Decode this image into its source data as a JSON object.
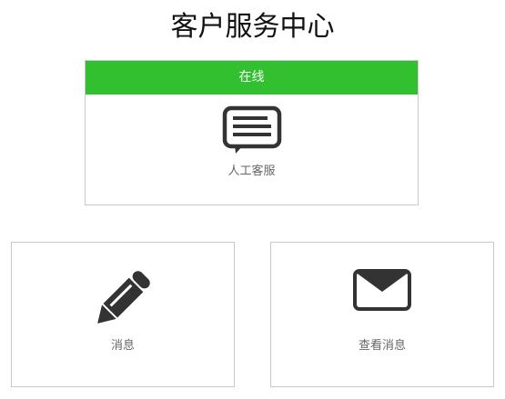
{
  "header": {
    "title": "客户服务中心"
  },
  "main_card": {
    "status": "在线",
    "label": "人工客服",
    "icon": "chat-bubble-icon",
    "status_color": "#33c030"
  },
  "cards": [
    {
      "label": "消息",
      "icon": "pencil-icon"
    },
    {
      "label": "查看消息",
      "icon": "envelope-icon"
    }
  ],
  "colors": {
    "accent": "#33c030",
    "icon": "#333333",
    "label": "#666666",
    "border": "#c9c9c9"
  }
}
